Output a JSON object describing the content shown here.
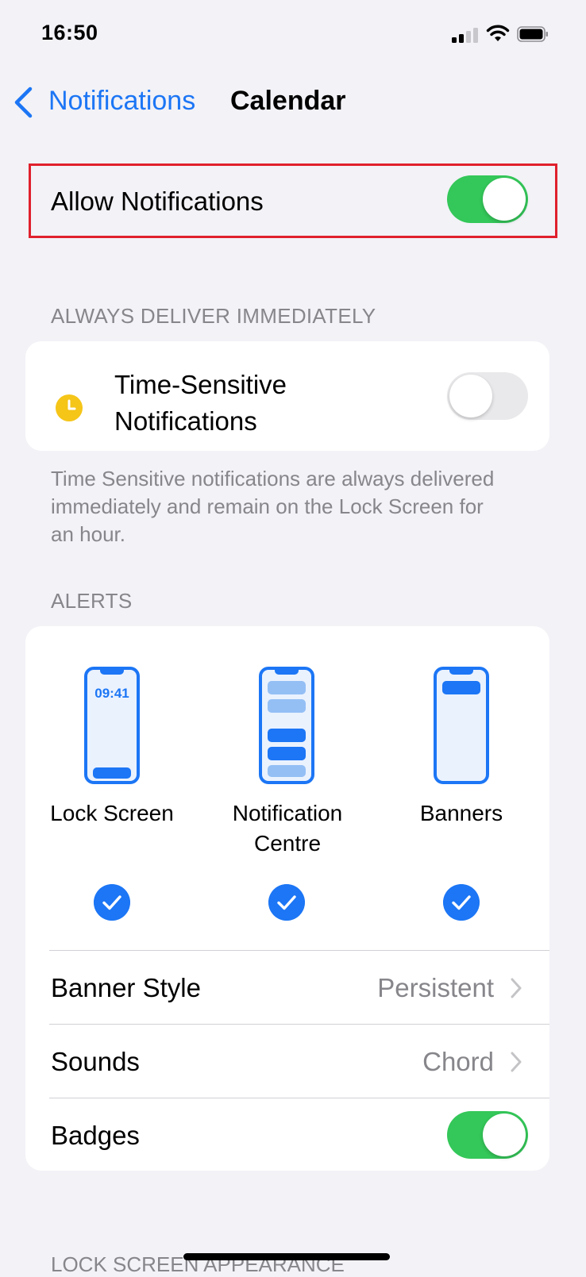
{
  "status_bar": {
    "time": "16:50"
  },
  "nav": {
    "back_label": "Notifications",
    "title": "Calendar"
  },
  "allow_notifications": {
    "label": "Allow Notifications",
    "enabled": true
  },
  "always_deliver": {
    "header": "ALWAYS DELIVER IMMEDIATELY",
    "time_sensitive_label": "Time-Sensitive Notifications",
    "time_sensitive_enabled": false,
    "footer": "Time Sensitive notifications are always delivered immediately and remain on the Lock Screen for an hour."
  },
  "alerts": {
    "header": "ALERTS",
    "lock_screen_time": "09:41",
    "options": [
      {
        "label": "Lock Screen",
        "icon": "lock-screen-phone-icon",
        "checked": true
      },
      {
        "label": "Notification Centre",
        "icon": "notification-centre-phone-icon",
        "checked": true
      },
      {
        "label": "Banners",
        "icon": "banners-phone-icon",
        "checked": true
      }
    ],
    "banner_style": {
      "label": "Banner Style",
      "value": "Persistent"
    },
    "sounds": {
      "label": "Sounds",
      "value": "Chord"
    },
    "badges": {
      "label": "Badges",
      "enabled": true
    }
  },
  "lock_screen_appearance": {
    "header": "LOCK SCREEN APPEARANCE"
  },
  "colors": {
    "accent": "#1c76f5",
    "toggle_on": "#34c759",
    "highlight_border": "#e0202d",
    "time_sensitive_icon": "#f5c518"
  }
}
